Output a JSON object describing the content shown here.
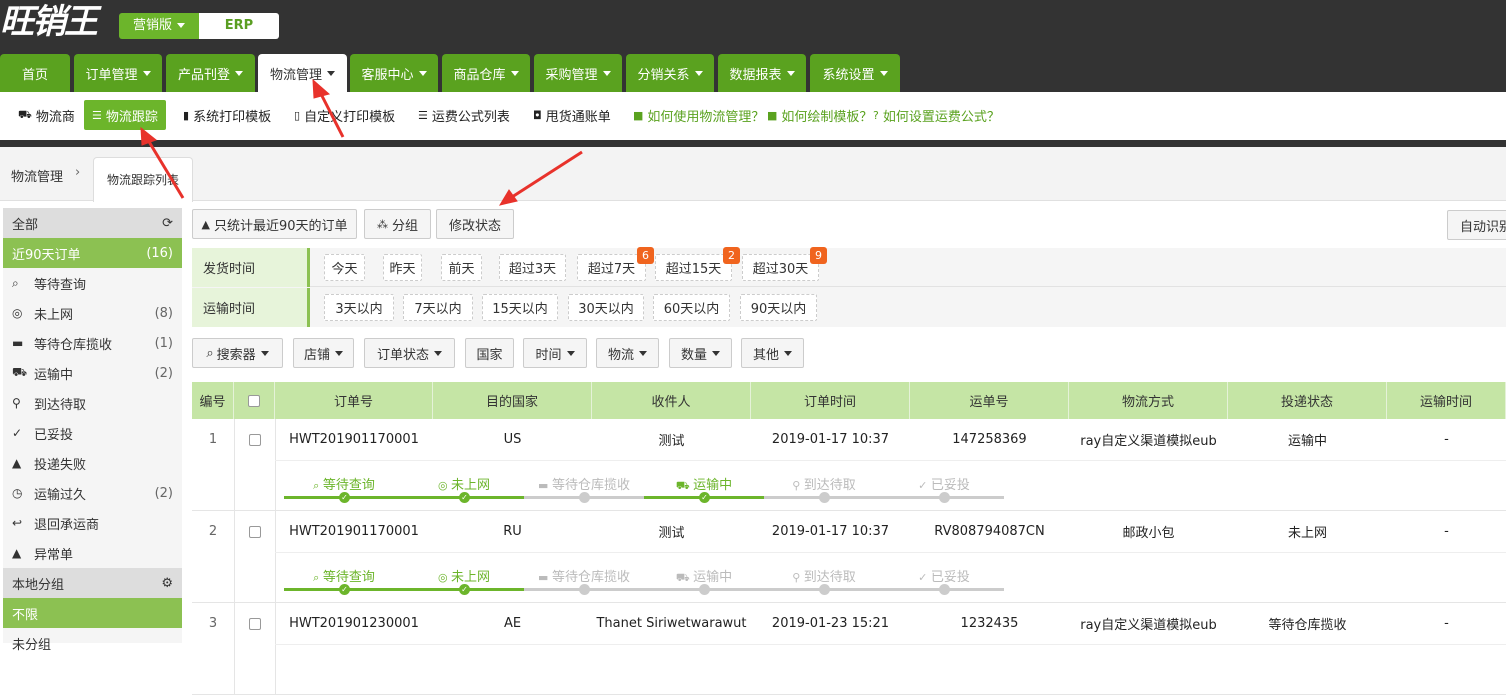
{
  "app": {
    "logo": "旺销王",
    "edition": "营销版",
    "erp": "ERP"
  },
  "nav": [
    {
      "label": "首页",
      "caret": false
    },
    {
      "label": "订单管理",
      "caret": true
    },
    {
      "label": "产品刊登",
      "caret": true
    },
    {
      "label": "物流管理",
      "caret": true,
      "active": true
    },
    {
      "label": "客服中心",
      "caret": true
    },
    {
      "label": "商品仓库",
      "caret": true
    },
    {
      "label": "采购管理",
      "caret": true
    },
    {
      "label": "分销关系",
      "caret": true
    },
    {
      "label": "数据报表",
      "caret": true
    },
    {
      "label": "系统设置",
      "caret": true
    }
  ],
  "subnav": [
    {
      "label": "物流商",
      "icon": "truck-icon"
    },
    {
      "label": "物流跟踪",
      "icon": "list-icon",
      "active": true
    },
    {
      "label": "系统打印模板",
      "icon": "bookmark-icon"
    },
    {
      "label": "自定义打印模板",
      "icon": "bookmark-outline-icon"
    },
    {
      "label": "运费公式列表",
      "icon": "list-icon"
    },
    {
      "label": "甩货通账单",
      "icon": "money-icon"
    },
    {
      "label": "如何使用物流管理？",
      "icon": "video-icon",
      "help": true
    },
    {
      "label": "如何绘制模板？",
      "icon": "video-icon",
      "help": true
    },
    {
      "label": "如何设置运费公式？",
      "icon": "question-icon",
      "help": true
    }
  ],
  "breadcrumb": {
    "root": "物流管理",
    "sep": "›",
    "tab": "物流跟踪列表"
  },
  "sidebar": {
    "header": "全部",
    "items": [
      {
        "label": "近90天订单",
        "count": "(16)",
        "icon": "",
        "active": true
      },
      {
        "label": "等待查询",
        "count": "",
        "icon": "search-icon"
      },
      {
        "label": "未上网",
        "count": "(8)",
        "icon": "eye-slash-icon"
      },
      {
        "label": "等待仓库揽收",
        "count": "(1)",
        "icon": "coffee-icon"
      },
      {
        "label": "运输中",
        "count": "(2)",
        "icon": "truck-icon"
      },
      {
        "label": "到达待取",
        "count": "",
        "icon": "map-marker-icon"
      },
      {
        "label": "已妥投",
        "count": "",
        "icon": "check-circle-icon"
      },
      {
        "label": "投递失败",
        "count": "",
        "icon": "warning-icon"
      },
      {
        "label": "运输过久",
        "count": "(2)",
        "icon": "clock-icon"
      },
      {
        "label": "退回承运商",
        "count": "",
        "icon": "reply-icon"
      },
      {
        "label": "异常单",
        "count": "",
        "icon": "warning-icon"
      }
    ],
    "group_header": "本地分组",
    "group_items": [
      {
        "label": "不限",
        "active": true
      },
      {
        "label": "未分组"
      }
    ]
  },
  "toolbar": {
    "notice": "只统计最近90天的订单",
    "group": "分组",
    "modify_status": "修改状态",
    "auto_identify": "自动识别"
  },
  "filters": {
    "ship_time_label": "发货时间",
    "ship_time_chips": [
      {
        "label": "今天",
        "badge": ""
      },
      {
        "label": "昨天",
        "badge": ""
      },
      {
        "label": "前天",
        "badge": ""
      },
      {
        "label": "超过3天",
        "badge": ""
      },
      {
        "label": "超过7天",
        "badge": "6"
      },
      {
        "label": "超过15天",
        "badge": "2"
      },
      {
        "label": "超过30天",
        "badge": "9"
      }
    ],
    "transit_time_label": "运输时间",
    "transit_time_chips": [
      "3天以内",
      "7天以内",
      "15天以内",
      "30天以内",
      "60天以内",
      "90天以内"
    ]
  },
  "filter_buttons": [
    {
      "label": "搜索器",
      "icon": "search-icon",
      "caret": true
    },
    {
      "label": "店铺",
      "caret": true
    },
    {
      "label": "订单状态",
      "caret": true
    },
    {
      "label": "国家",
      "caret": false
    },
    {
      "label": "时间",
      "caret": true
    },
    {
      "label": "物流",
      "caret": true
    },
    {
      "label": "数量",
      "caret": true
    },
    {
      "label": "其他",
      "caret": true
    }
  ],
  "table": {
    "headers": [
      "编号",
      "",
      "订单号",
      "目的国家",
      "收件人",
      "订单时间",
      "运单号",
      "物流方式",
      "投递状态",
      "运输时间"
    ],
    "steps": [
      "等待查询",
      "未上网",
      "等待仓库揽收",
      "运输中",
      "到达待取",
      "已妥投"
    ],
    "rows": [
      {
        "no": "1",
        "order": "HWT201901170001",
        "country": "US",
        "recipient": "测试",
        "time": "2019-01-17 10:37",
        "tracking": "147258369",
        "method": "ray自定义渠道模拟eub",
        "status": "运输中",
        "transit": "-",
        "progress": [
          true,
          true,
          false,
          true,
          false,
          false
        ]
      },
      {
        "no": "2",
        "order": "HWT201901170001",
        "country": "RU",
        "recipient": "测试",
        "time": "2019-01-17 10:37",
        "tracking": "RV808794087CN",
        "method": "邮政小包",
        "status": "未上网",
        "transit": "-",
        "progress": [
          true,
          true,
          false,
          false,
          false,
          false
        ]
      },
      {
        "no": "3",
        "order": "HWT201901230001",
        "country": "AE",
        "recipient": "Thanet Siriwetwarawut",
        "time": "2019-01-23 15:21",
        "tracking": "1232435",
        "method": "ray自定义渠道模拟eub",
        "status": "等待仓库揽收",
        "transit": "-"
      }
    ]
  },
  "colors": {
    "brand_green": "#6cb52b",
    "nav_dark": "#333333",
    "header_green": "#c5e5a5",
    "badge_orange": "#f0641e",
    "arrow_red": "#e8322b"
  }
}
